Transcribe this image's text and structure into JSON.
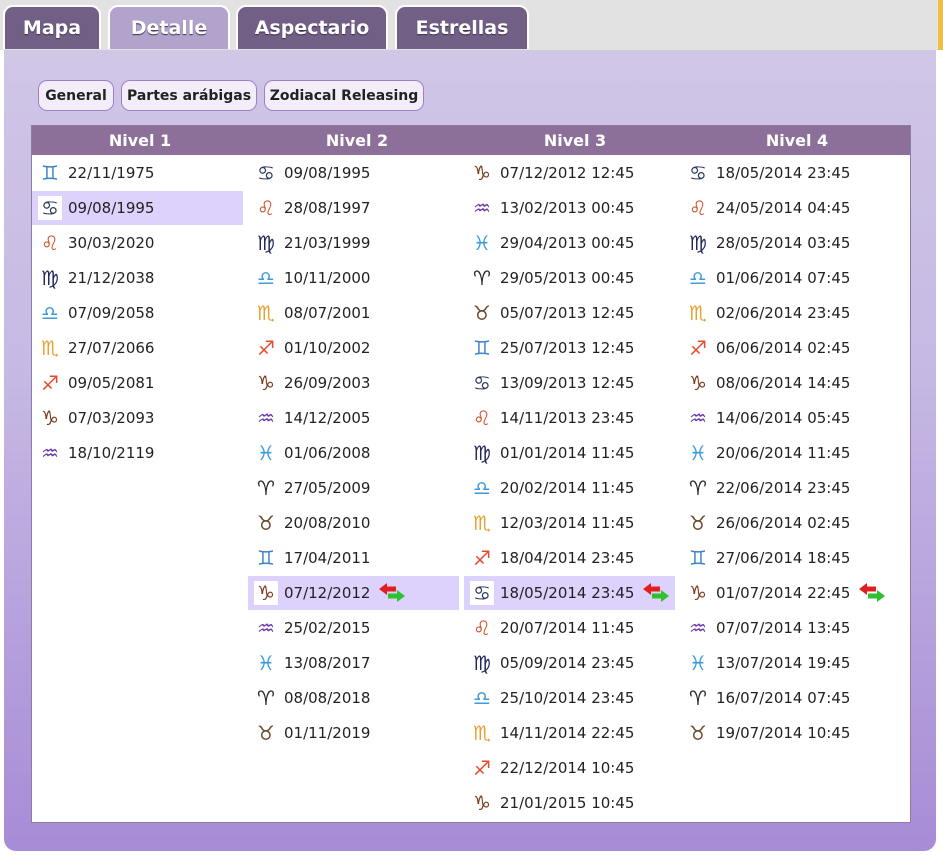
{
  "tabs": [
    {
      "label": "Mapa",
      "active": false
    },
    {
      "label": "Detalle",
      "active": true
    },
    {
      "label": "Aspectario",
      "active": false
    },
    {
      "label": "Estrellas",
      "active": false
    }
  ],
  "subtabs": [
    "General",
    "Partes arábigas",
    "Zodiacal Releasing"
  ],
  "signs": {
    "aries": {
      "glyph": "♈",
      "color": "#2b2b2b"
    },
    "taurus": {
      "glyph": "♉",
      "color": "#6b4a2a"
    },
    "gemini": {
      "glyph": "♊",
      "color": "#3f86c8"
    },
    "cancer": {
      "glyph": "♋",
      "color": "#2b3a5a"
    },
    "leo": {
      "glyph": "♌",
      "color": "#d2502a"
    },
    "virgo": {
      "glyph": "♍",
      "color": "#22285a"
    },
    "libra": {
      "glyph": "♎",
      "color": "#3f9ad8"
    },
    "scorpio": {
      "glyph": "♏",
      "color": "#e8a030"
    },
    "sagittarius": {
      "glyph": "♐",
      "color": "#e64a2a"
    },
    "capricorn": {
      "glyph": "♑",
      "color": "#7a3a1a"
    },
    "aquarius": {
      "glyph": "♒",
      "color": "#6a3aa8"
    },
    "pisces": {
      "glyph": "♓",
      "color": "#3a9ae0"
    }
  },
  "levels": [
    {
      "header": "Nivel 1",
      "rows": [
        {
          "sign": "gemini",
          "date": "22/11/1975"
        },
        {
          "sign": "cancer",
          "date": "09/08/1995",
          "selected": true
        },
        {
          "sign": "leo",
          "date": "30/03/2020"
        },
        {
          "sign": "virgo",
          "date": "21/12/2038"
        },
        {
          "sign": "libra",
          "date": "07/09/2058"
        },
        {
          "sign": "scorpio",
          "date": "27/07/2066"
        },
        {
          "sign": "sagittarius",
          "date": "09/05/2081"
        },
        {
          "sign": "capricorn",
          "date": "07/03/2093"
        },
        {
          "sign": "aquarius",
          "date": "18/10/2119"
        }
      ]
    },
    {
      "header": "Nivel 2",
      "rows": [
        {
          "sign": "cancer",
          "date": "09/08/1995"
        },
        {
          "sign": "leo",
          "date": "28/08/1997"
        },
        {
          "sign": "virgo",
          "date": "21/03/1999"
        },
        {
          "sign": "libra",
          "date": "10/11/2000"
        },
        {
          "sign": "scorpio",
          "date": "08/07/2001"
        },
        {
          "sign": "sagittarius",
          "date": "01/10/2002"
        },
        {
          "sign": "capricorn",
          "date": "26/09/2003"
        },
        {
          "sign": "aquarius",
          "date": "14/12/2005"
        },
        {
          "sign": "pisces",
          "date": "01/06/2008"
        },
        {
          "sign": "aries",
          "date": "27/05/2009"
        },
        {
          "sign": "taurus",
          "date": "20/08/2010"
        },
        {
          "sign": "gemini",
          "date": "17/04/2011"
        },
        {
          "sign": "capricorn",
          "date": "07/12/2012",
          "selected": true,
          "swap": true
        },
        {
          "sign": "aquarius",
          "date": "25/02/2015"
        },
        {
          "sign": "pisces",
          "date": "13/08/2017"
        },
        {
          "sign": "aries",
          "date": "08/08/2018"
        },
        {
          "sign": "taurus",
          "date": "01/11/2019"
        }
      ]
    },
    {
      "header": "Nivel 3",
      "rows": [
        {
          "sign": "capricorn",
          "date": "07/12/2012 12:45"
        },
        {
          "sign": "aquarius",
          "date": "13/02/2013 00:45"
        },
        {
          "sign": "pisces",
          "date": "29/04/2013 00:45"
        },
        {
          "sign": "aries",
          "date": "29/05/2013 00:45"
        },
        {
          "sign": "taurus",
          "date": "05/07/2013 12:45"
        },
        {
          "sign": "gemini",
          "date": "25/07/2013 12:45"
        },
        {
          "sign": "cancer",
          "date": "13/09/2013 12:45"
        },
        {
          "sign": "leo",
          "date": "14/11/2013 23:45"
        },
        {
          "sign": "virgo",
          "date": "01/01/2014 11:45"
        },
        {
          "sign": "libra",
          "date": "20/02/2014 11:45"
        },
        {
          "sign": "scorpio",
          "date": "12/03/2014 11:45"
        },
        {
          "sign": "sagittarius",
          "date": "18/04/2014 23:45"
        },
        {
          "sign": "cancer",
          "date": "18/05/2014 23:45",
          "selected": true,
          "swap": true
        },
        {
          "sign": "leo",
          "date": "20/07/2014 11:45"
        },
        {
          "sign": "virgo",
          "date": "05/09/2014 23:45"
        },
        {
          "sign": "libra",
          "date": "25/10/2014 23:45"
        },
        {
          "sign": "scorpio",
          "date": "14/11/2014 22:45"
        },
        {
          "sign": "sagittarius",
          "date": "22/12/2014 10:45"
        },
        {
          "sign": "capricorn",
          "date": "21/01/2015 10:45"
        }
      ]
    },
    {
      "header": "Nivel 4",
      "rows": [
        {
          "sign": "cancer",
          "date": "18/05/2014 23:45"
        },
        {
          "sign": "leo",
          "date": "24/05/2014 04:45"
        },
        {
          "sign": "virgo",
          "date": "28/05/2014 03:45"
        },
        {
          "sign": "libra",
          "date": "01/06/2014 07:45"
        },
        {
          "sign": "scorpio",
          "date": "02/06/2014 23:45"
        },
        {
          "sign": "sagittarius",
          "date": "06/06/2014 02:45"
        },
        {
          "sign": "capricorn",
          "date": "08/06/2014 14:45"
        },
        {
          "sign": "aquarius",
          "date": "14/06/2014 05:45"
        },
        {
          "sign": "pisces",
          "date": "20/06/2014 11:45"
        },
        {
          "sign": "aries",
          "date": "22/06/2014 23:45"
        },
        {
          "sign": "taurus",
          "date": "26/06/2014 02:45"
        },
        {
          "sign": "gemini",
          "date": "27/06/2014 18:45"
        },
        {
          "sign": "capricorn",
          "date": "01/07/2014 22:45",
          "swap": true
        },
        {
          "sign": "aquarius",
          "date": "07/07/2014 13:45"
        },
        {
          "sign": "pisces",
          "date": "13/07/2014 19:45"
        },
        {
          "sign": "aries",
          "date": "16/07/2014 07:45"
        },
        {
          "sign": "taurus",
          "date": "19/07/2014 10:45"
        }
      ]
    }
  ]
}
